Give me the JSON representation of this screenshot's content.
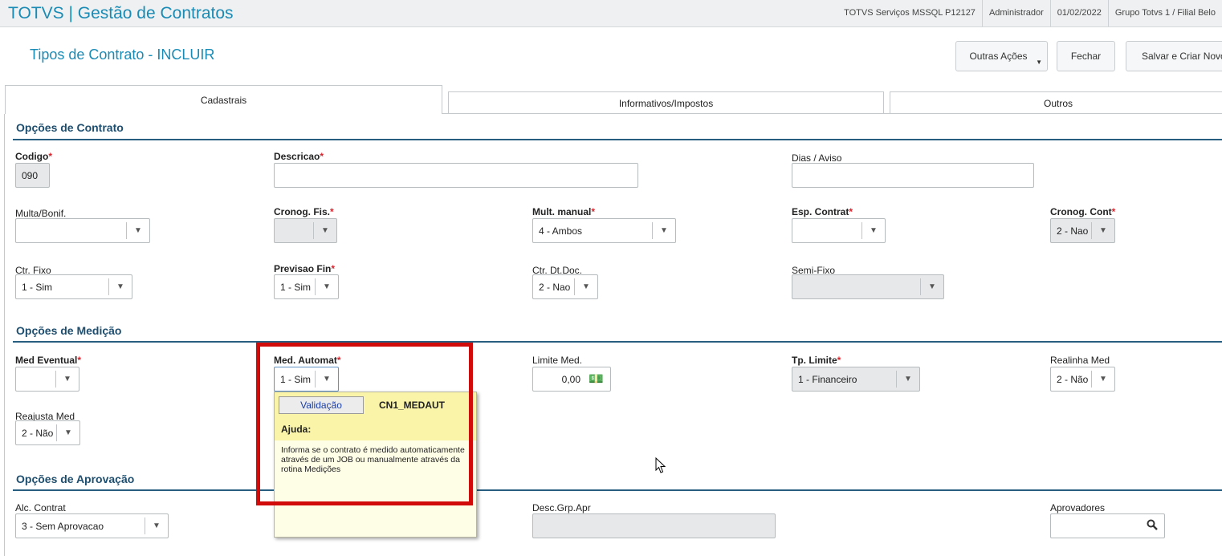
{
  "app": {
    "title": "TOTVS | Gestão de Contratos"
  },
  "top_info": [
    "TOTVS Serviços MSSQL P12127",
    "Administrador",
    "01/02/2022",
    "Grupo Totvs 1 / Filial Belo"
  ],
  "page": {
    "title": "Tipos de Contrato - INCLUIR"
  },
  "toolbar": {
    "outras_acoes": "Outras Ações",
    "fechar": "Fechar",
    "salvar": "Salvar e Criar Novo"
  },
  "tabs": [
    "Cadastrais",
    "Informativos/Impostos",
    "Outros"
  ],
  "sections": {
    "contrato": "Opções de Contrato",
    "medicao": "Opções de Medição",
    "aprovacao": "Opções de Aprovação"
  },
  "fields": {
    "codigo": {
      "label": "Codigo",
      "value": "090"
    },
    "descricao": {
      "label": "Descricao",
      "value": ""
    },
    "dias_aviso": {
      "label": "Dias / Aviso",
      "value": ""
    },
    "multa_bonif": {
      "label": "Multa/Bonif.",
      "value": ""
    },
    "cronog_fis": {
      "label": "Cronog. Fis.",
      "value": ""
    },
    "mult_manual": {
      "label": "Mult. manual",
      "value": "4 - Ambos"
    },
    "esp_contrat": {
      "label": "Esp. Contrat",
      "value": ""
    },
    "cronog_cont": {
      "label": "Cronog. Cont",
      "value": "2 - Nao"
    },
    "ctr_fixo": {
      "label": "Ctr. Fixo",
      "value": "1 - Sim"
    },
    "previsao_fin": {
      "label": "Previsao Fin",
      "value": "1 - Sim"
    },
    "ctr_dt_doc": {
      "label": "Ctr. Dt.Doc.",
      "value": "2 - Nao"
    },
    "semi_fixo": {
      "label": "Semi-Fixo",
      "value": ""
    },
    "med_eventual": {
      "label": "Med Eventual",
      "value": ""
    },
    "med_automat": {
      "label": "Med. Automat",
      "value": "1 - Sim"
    },
    "limite_med": {
      "label": "Limite Med.",
      "value": "0,00"
    },
    "tp_limite": {
      "label": "Tp. Limite",
      "value": "1 - Financeiro"
    },
    "realinha_med": {
      "label": "Realinha Med",
      "value": "2 - Não"
    },
    "reajusta_med": {
      "label": "Reajusta Med",
      "value": "2 - Não"
    },
    "alc_contrat": {
      "label": "Alc. Contrat",
      "value": "3 - Sem Aprovacao"
    },
    "desc_grp_apr": {
      "label": "Desc.Grp.Apr",
      "value": ""
    },
    "aprovadores": {
      "label": "Aprovadores",
      "value": ""
    }
  },
  "tooltip": {
    "button": "Validação",
    "code": "CN1_MEDAUT",
    "ajuda": "Ajuda:",
    "text": "Informa se o contrato é medido automaticamente através de um JOB ou manualmente através da rotina Medições"
  },
  "required_mark": "*",
  "icons": {
    "dropdown": "chevron-down-icon",
    "search": "search-icon",
    "money": "money-icon"
  },
  "colors": {
    "accent": "#1a8bb5",
    "section": "#1d4e6f",
    "required": "#d9232c",
    "highlight": "#d10a0a"
  }
}
